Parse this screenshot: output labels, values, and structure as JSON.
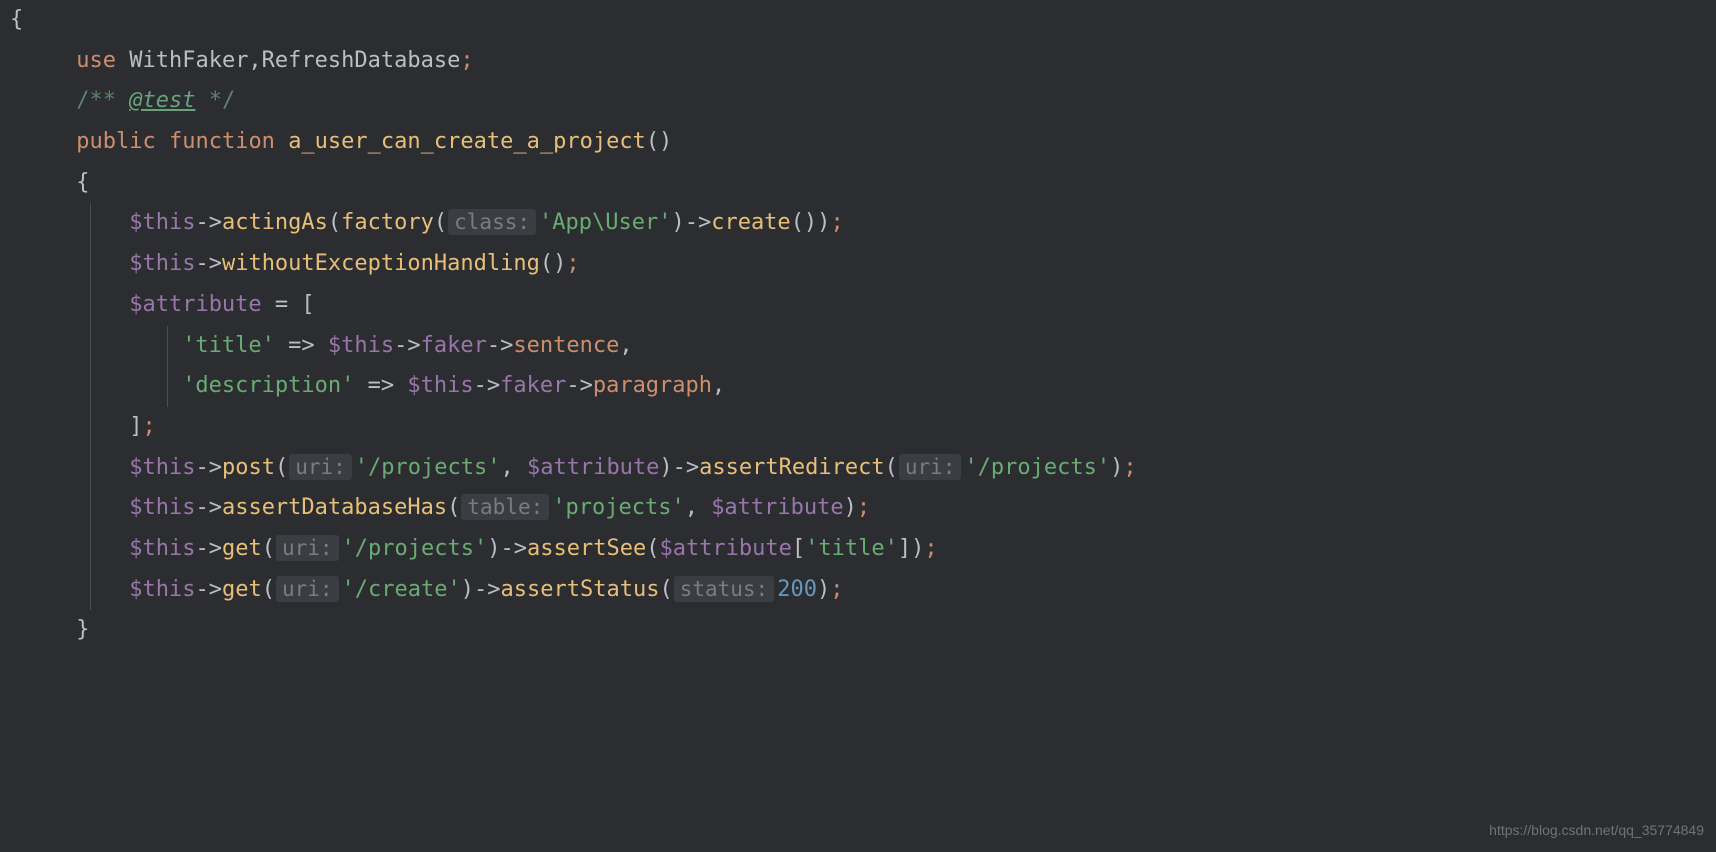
{
  "watermark": "https://blog.csdn.net/qq_35774849",
  "code": {
    "line1_brace": "{",
    "line2_use": "use",
    "line2_traits": " WithFaker,RefreshDatabase",
    "line2_semi": ";",
    "line3_open": "/** ",
    "line3_tag": "@test",
    "line3_close": " */",
    "line4_public": "public",
    "line4_function": "function",
    "line4_name": "a_user_can_create_a_project",
    "line5_brace": "{",
    "line6_this": "$this",
    "line6_arrow": "->",
    "line6_acting": "actingAs",
    "line6_lparen": "(",
    "line6_factory": "factory",
    "line6_lparen2": "(",
    "line6_hint": "class:",
    "line6_str": "'App\\User'",
    "line6_rparen": ")",
    "line6_arrow2": "->",
    "line6_create": "create",
    "line6_rparen_all": "());",
    "line7_this": "$this",
    "line7_arrow": "->",
    "line7_method": "withoutExceptionHandling",
    "line7_rest": "();",
    "line8_attr": "$attribute",
    "line8_eq": " = [",
    "line9_key": "'title'",
    "line9_arrow": " => ",
    "line9_this": "$this",
    "line9_arr": "->",
    "line9_faker": "faker",
    "line9_arr2": "->",
    "line9_sentence": "sentence",
    "line9_comma": ",",
    "line10_key": "'description'",
    "line10_arrow": " => ",
    "line10_this": "$this",
    "line10_arr": "->",
    "line10_faker": "faker",
    "line10_arr2": "->",
    "line10_para": "paragraph",
    "line10_comma": ",",
    "line11_close": "];",
    "line12_this": "$this",
    "line12_arrow": "->",
    "line12_post": "post",
    "line12_lp": "(",
    "line12_hint": "uri:",
    "line12_str": "'/projects'",
    "line12_comma": ", ",
    "line12_attr": "$attribute",
    "line12_rp": ")",
    "line12_arrow2": "->",
    "line12_redirect": "assertRedirect",
    "line12_lp2": "(",
    "line12_hint2": "uri:",
    "line12_str2": "'/projects'",
    "line12_end": ");",
    "line13_this": "$this",
    "line13_arrow": "->",
    "line13_method": "assertDatabaseHas",
    "line13_lp": "(",
    "line13_hint": "table:",
    "line13_str": "'projects'",
    "line13_comma": ", ",
    "line13_attr": "$attribute",
    "line13_end": ");",
    "line14_this": "$this",
    "line14_arrow": "->",
    "line14_get": "get",
    "line14_lp": "(",
    "line14_hint": "uri:",
    "line14_str": "'/projects'",
    "line14_rp": ")",
    "line14_arrow2": "->",
    "line14_see": "assertSee",
    "line14_lp2": "(",
    "line14_attr": "$attribute",
    "line14_lb": "[",
    "line14_key": "'title'",
    "line14_rb": "]",
    "line14_end": ");",
    "line15_this": "$this",
    "line15_arrow": "->",
    "line15_get": "get",
    "line15_lp": "(",
    "line15_hint": "uri:",
    "line15_str": "'/create'",
    "line15_rp": ")",
    "line15_arrow2": "->",
    "line15_status": "assertStatus",
    "line15_lp2": "(",
    "line15_hint2": "status:",
    "line15_num": "200",
    "line15_end": ");",
    "line16_brace": "}"
  }
}
